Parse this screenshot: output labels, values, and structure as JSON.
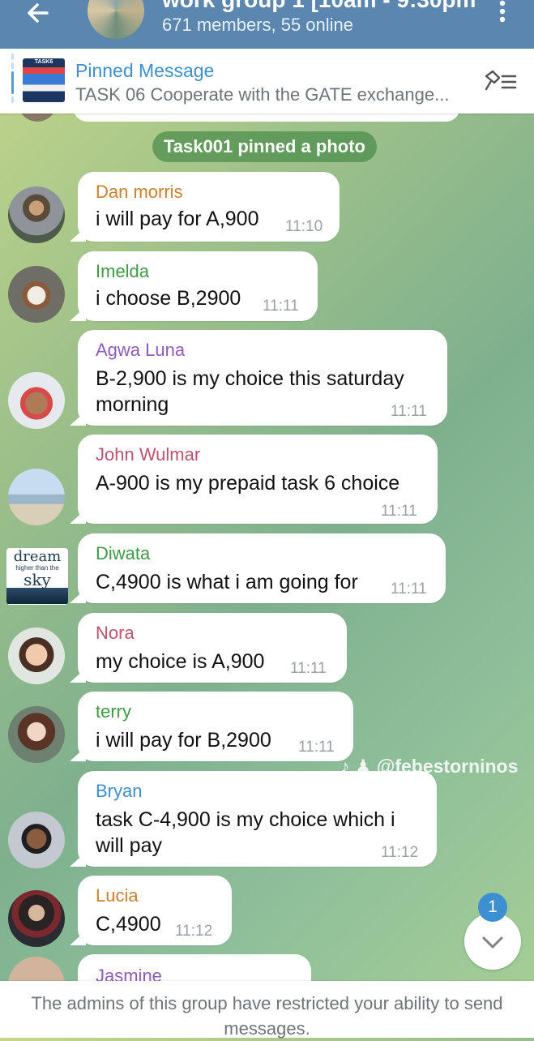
{
  "header": {
    "title": "work group 1 [10am - 9:30pm",
    "subtitle": "671 members, 55 online"
  },
  "pinned": {
    "title": "Pinned Message",
    "text": "TASK 06  Cooperate with the GATE exchange...",
    "thumb_label": "TASK6"
  },
  "service_message": "Task001 pinned a photo",
  "messages": [
    {
      "sender": "Dan morris",
      "color": "#d07f2e",
      "text": "i will pay for A,900",
      "time": "11:10"
    },
    {
      "sender": "Imelda",
      "color": "#3f9a46",
      "text": "i choose B,2900",
      "time": "11:11"
    },
    {
      "sender": "Agwa Luna",
      "color": "#8f5bc0",
      "text": "B-2,900 is my choice this saturday morning",
      "time": "11:11"
    },
    {
      "sender": "John Wulmar",
      "color": "#c0526c",
      "text": "A-900 is my prepaid task 6 choice",
      "time": "11:11"
    },
    {
      "sender": "Diwata",
      "color": "#3f9a46",
      "text": "C,4900 is what i am going for",
      "time": "11:11"
    },
    {
      "sender": "Nora",
      "color": "#c0526c",
      "text": "my choice is A,900",
      "time": "11:11"
    },
    {
      "sender": "terry",
      "color": "#3f9a46",
      "text": "i will pay for B,2900",
      "time": "11:11"
    },
    {
      "sender": "Bryan",
      "color": "#3d8fd1",
      "text": "task C-4,900 is my choice which i will pay",
      "time": "11:12"
    },
    {
      "sender": "Lucia",
      "color": "#d07f2e",
      "text": "C,4900",
      "time": "11:12"
    },
    {
      "sender": "Jasmine",
      "color": "#8f5bc0"
    }
  ],
  "diwata_avatar": {
    "line1": "dream",
    "line2": "higher than the",
    "line3": "sky"
  },
  "watermark": "♪ ♟ @febestorninos",
  "unread_count": "1",
  "footer": "The admins of this group have restricted your ability to send messages."
}
